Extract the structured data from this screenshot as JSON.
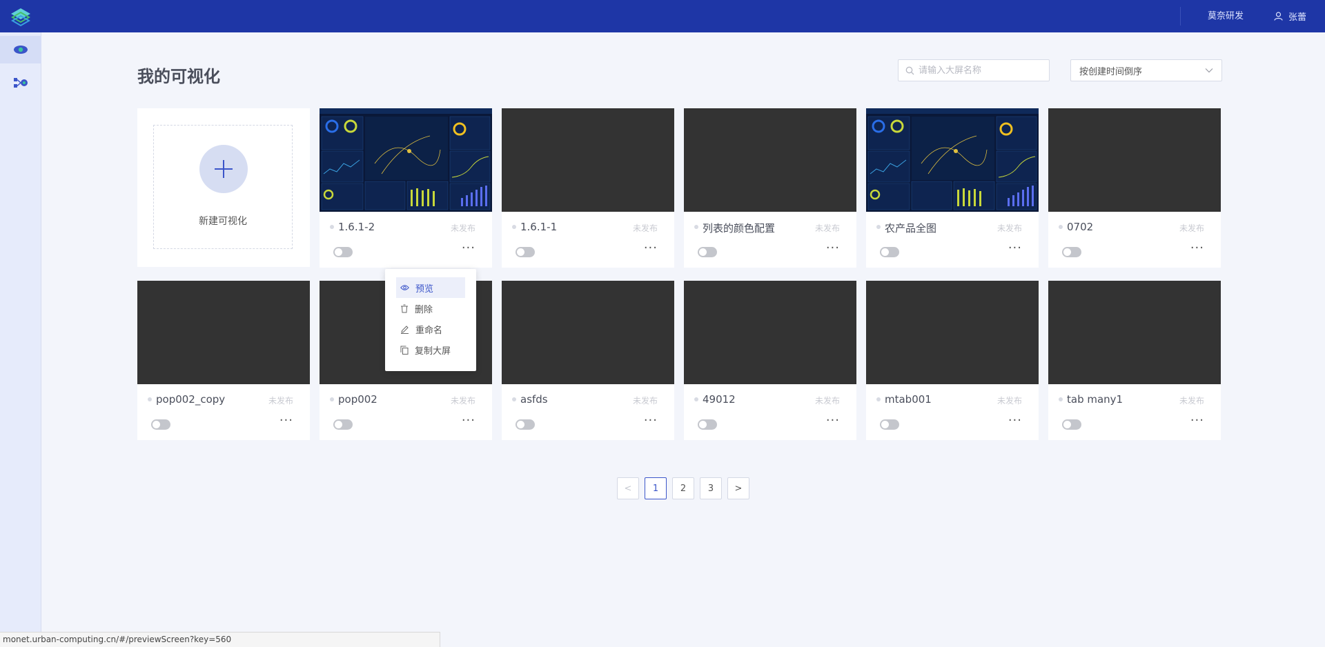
{
  "header": {
    "org": "莫奈研发",
    "user": "张蕾",
    "brand_color": "#1e36a6"
  },
  "sidebar": {
    "items": [
      {
        "icon": "eye-icon",
        "active": true
      },
      {
        "icon": "flow-icon",
        "active": false
      }
    ]
  },
  "page": {
    "title": "我的可视化"
  },
  "search": {
    "placeholder": "请输入大屏名称",
    "value": ""
  },
  "sort": {
    "selected": "按创建时间倒序"
  },
  "new_card": {
    "label": "新建可视化"
  },
  "cards": [
    {
      "name": "1.6.1-2",
      "status": "未发布",
      "thumb": "dashboard"
    },
    {
      "name": "1.6.1-1",
      "status": "未发布",
      "thumb": "blank"
    },
    {
      "name": "列表的颜色配置",
      "status": "未发布",
      "thumb": "blank"
    },
    {
      "name": "农产品全图",
      "status": "未发布",
      "thumb": "dashboard"
    },
    {
      "name": "0702",
      "status": "未发布",
      "thumb": "blank"
    },
    {
      "name": "pop002_copy",
      "status": "未发布",
      "thumb": "blank"
    },
    {
      "name": "pop002",
      "status": "未发布",
      "thumb": "blank"
    },
    {
      "name": "asfds",
      "status": "未发布",
      "thumb": "blank"
    },
    {
      "name": "49012",
      "status": "未发布",
      "thumb": "blank"
    },
    {
      "name": "mtab001",
      "status": "未发布",
      "thumb": "blank"
    },
    {
      "name": "tab many1",
      "status": "未发布",
      "thumb": "blank"
    }
  ],
  "more_label": "···",
  "context_menu": {
    "items": [
      {
        "label": "预览",
        "icon": "eye-icon",
        "active": true
      },
      {
        "label": "删除",
        "icon": "trash-icon",
        "active": false
      },
      {
        "label": "重命名",
        "icon": "edit-icon",
        "active": false
      },
      {
        "label": "复制大屏",
        "icon": "copy-icon",
        "active": false
      }
    ]
  },
  "pagination": {
    "prev": "<",
    "next": ">",
    "pages": [
      "1",
      "2",
      "3"
    ],
    "current": "1"
  },
  "statusbar": {
    "url": "monet.urban-computing.cn/#/previewScreen?key=560"
  }
}
